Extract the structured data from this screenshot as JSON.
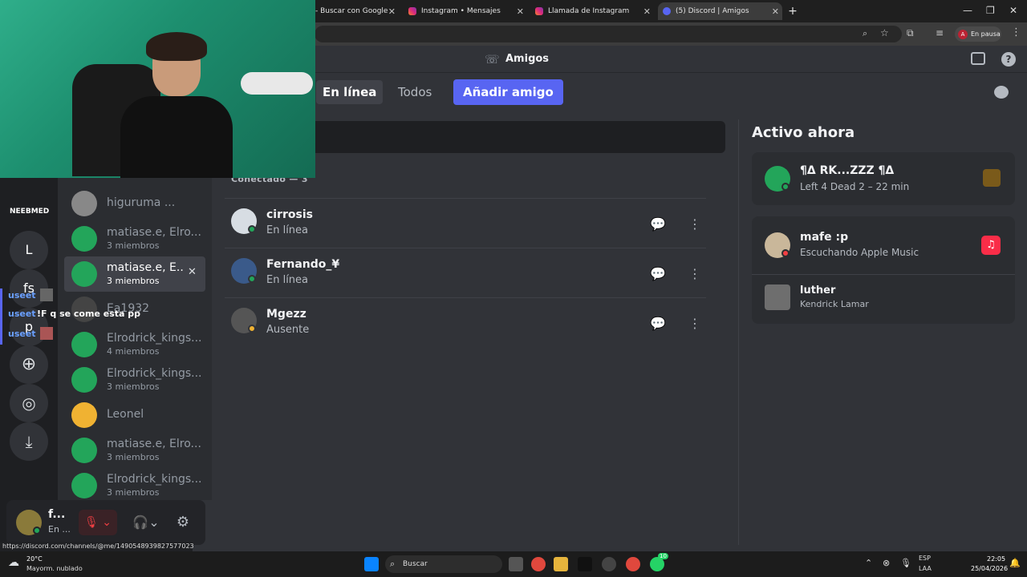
{
  "browser": {
    "tabs": [
      {
        "label": "- Buscar con Google"
      },
      {
        "label": "Instagram • Mensajes"
      },
      {
        "label": "Llamada de Instagram"
      },
      {
        "label": "(5) Discord | Amigos"
      }
    ],
    "profile_label": "En pausa",
    "profile_initial": "A",
    "status_url": "https://discord.com/channels/@me/1490548939827577023"
  },
  "guilds": {
    "labels": [
      "NEEBMED",
      "L",
      "fs",
      "p"
    ]
  },
  "chat_overlay": {
    "lines": [
      {
        "user": "useet",
        "text": ""
      },
      {
        "user": "useet",
        "text": "!F q se come esta pp"
      },
      {
        "user": "useet",
        "text": ""
      }
    ]
  },
  "dm_list": [
    {
      "name": "higuruma ...",
      "sub": ""
    },
    {
      "name": "matiase.e, Elro...",
      "sub": "3 miembros"
    },
    {
      "name": "matiase.e, E...",
      "sub": "3 miembros"
    },
    {
      "name": "Ea1932",
      "sub": ""
    },
    {
      "name": "Elrodrick_kings...",
      "sub": "4 miembros"
    },
    {
      "name": "Elrodrick_kings...",
      "sub": "3 miembros"
    },
    {
      "name": "Leonel",
      "sub": ""
    },
    {
      "name": "matiase.e, Elro...",
      "sub": "3 miembros"
    },
    {
      "name": "Elrodrick_kings...",
      "sub": "3 miembros"
    }
  ],
  "user_panel": {
    "name": "f...",
    "status": "En ..."
  },
  "header": {
    "title": "Amigos",
    "tabs": [
      {
        "label": "En línea"
      },
      {
        "label": "Todos"
      }
    ],
    "add_friend_label": "Añadir amigo"
  },
  "friends": {
    "section_label": "Conectado — 3",
    "rows": [
      {
        "name": "cirrosis",
        "status": "En línea"
      },
      {
        "name": "Fernando_¥",
        "status": "En línea"
      },
      {
        "name": "Mgezz",
        "status": "Ausente"
      }
    ]
  },
  "active_now": {
    "title": "Activo ahora",
    "card1": {
      "name": "¶Δ RK...ZZZ ¶Δ",
      "activity": "Left 4 Dead 2 – 22 min"
    },
    "card2": {
      "name": "mafe :p",
      "activity": "Escuchando Apple Music"
    },
    "track": {
      "title": "luther",
      "artist": "Kendrick Lamar"
    }
  },
  "taskbar": {
    "weather_temp": "20°C",
    "weather_desc": "Mayorm. nublado",
    "search_label": "Buscar",
    "lang": "ESP",
    "lang_sub": "LAA",
    "time": "22:05",
    "date": "25/04/2026",
    "whatsapp_badge": "10"
  },
  "colors": {
    "blurple": "#5865f2",
    "online": "#23a55a",
    "idle": "#f0b232",
    "dnd": "#f23f43",
    "bg_main": "#313338",
    "bg_sidebar": "#2b2d31"
  }
}
